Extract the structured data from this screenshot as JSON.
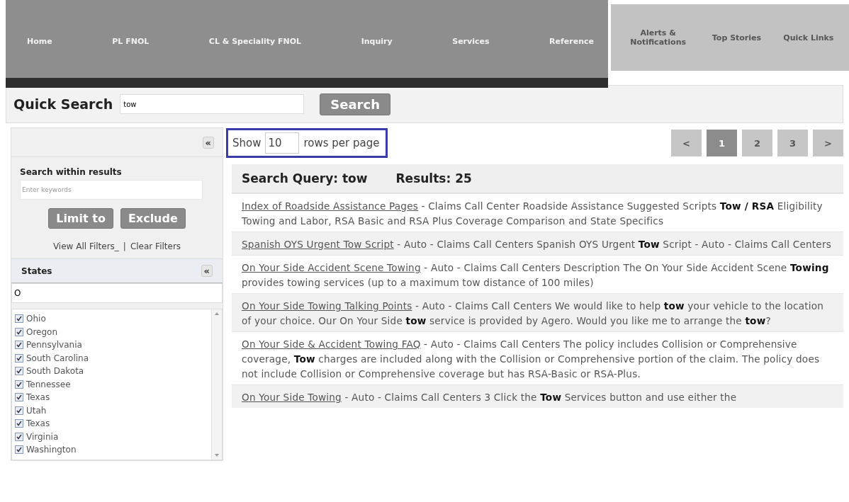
{
  "nav": {
    "primary": [
      {
        "label": "Home"
      },
      {
        "label": "PL FNOL"
      },
      {
        "label": "CL & Speciality FNOL"
      },
      {
        "label": "Inquiry"
      },
      {
        "label": "Services"
      },
      {
        "label": "Reference"
      }
    ],
    "secondary": [
      {
        "label": "Alerts & Notifications"
      },
      {
        "label": "Top Stories"
      },
      {
        "label": "Quick Links"
      }
    ]
  },
  "quick_search": {
    "label": "Quick Search",
    "value": "tow",
    "button": "Search"
  },
  "filters": {
    "collapse": "«",
    "within_label": "Search within results",
    "within_placeholder": "Enter keywords",
    "buttons": [
      "Limit to",
      "Exclude"
    ],
    "view_all": "View All Filters_",
    "separator": "|",
    "clear": "Clear Filters",
    "states": {
      "title": "States",
      "collapse": "«",
      "filter_value": "O",
      "items": [
        {
          "label": "Ohio",
          "checked": true
        },
        {
          "label": "Oregon",
          "checked": true
        },
        {
          "label": "Pennsylvania",
          "checked": true
        },
        {
          "label": "South Carolina",
          "checked": true
        },
        {
          "label": "South Dakota",
          "checked": true
        },
        {
          "label": "Tennessee",
          "checked": true
        },
        {
          "label": "Texas",
          "checked": true
        },
        {
          "label": "Utah",
          "checked": true
        },
        {
          "label": "Texas",
          "checked": true
        },
        {
          "label": "Virginia",
          "checked": true
        },
        {
          "label": "Washington",
          "checked": true
        }
      ]
    }
  },
  "rows_per_page": {
    "prefix": "Show",
    "value": "10",
    "suffix": "rows per page"
  },
  "pagination": [
    {
      "label": "<",
      "selected": false
    },
    {
      "label": "1",
      "selected": true
    },
    {
      "label": "2",
      "selected": false
    },
    {
      "label": "3",
      "selected": false
    },
    {
      "label": ">",
      "selected": false
    }
  ],
  "results_header": {
    "query": "Search Query: tow",
    "count": "Results: 25"
  },
  "results": [
    {
      "title": "Index of Roadside Assistance Pages",
      "text": " - Claims Call Center Roadside Assistance Suggested Scripts **Tow / RSA** Eligibility Towing and Labor, RSA Basic and RSA Plus Coverage Comparison and State Specifics"
    },
    {
      "title": "Spanish OYS Urgent Tow Script",
      "text": " - Auto - Claims Call Centers Spanish OYS Urgent **Tow** Script - Auto - Claims Call Centers"
    },
    {
      "title": "On Your Side Accident Scene Towing",
      "text": " - Auto - Claims Call Centers Description The On Your Side Accident Scene **Towing** provides towing services (up to a maximum tow distance of 100 miles)"
    },
    {
      "title": "On Your Side Towing Talking Points",
      "text": " - Auto - Claims Call Centers We would like to help **tow** your vehicle to the location of your choice. Our On Your Side **tow** service is provided by Agero. Would you like me to arrange the **tow**?"
    },
    {
      "title": "On Your Side & Accident Towing FAQ",
      "text": " - Auto - Claims Call Centers The policy includes Collision or Comprehensive coverage, **Tow** charges are included along with the Collision or Comprehensive portion of the claim. The policy does not include Collision or Comprehensive coverage but has RSA-Basic or RSA-Plus."
    },
    {
      "title": "On Your Side Towing",
      "text": " - Auto - Claims Call Centers 3 Click the **Tow** Services button and use either the"
    }
  ]
}
